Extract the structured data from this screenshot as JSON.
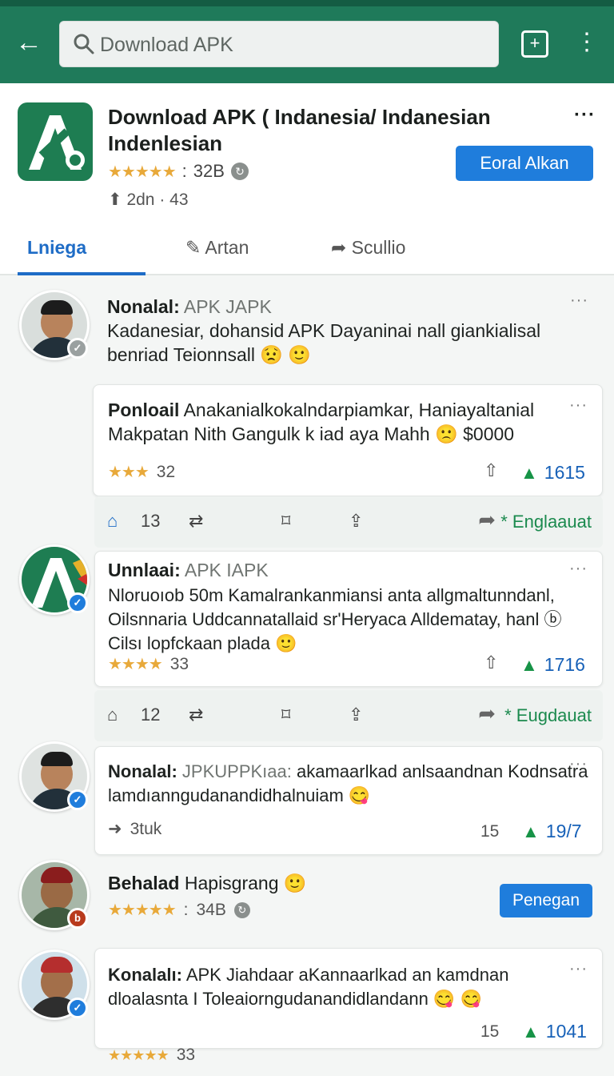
{
  "topbar": {
    "search_placeholder": "Download APK",
    "back_icon": "arrow-left-icon",
    "box_icon": "plus-box-icon",
    "more_icon": "more-vertical-icon"
  },
  "app": {
    "title": "Download APK ( Indanesia/ Indanesian Indenlesian",
    "stars": "★★★★★",
    "rating_sep": ":",
    "rating_value": "32B",
    "sub": "2dn · 43"
  },
  "tabs": [
    {
      "label": "Lniega"
    },
    {
      "label": "Artan"
    },
    {
      "label": "Scullio"
    }
  ],
  "tab_button": "Eoral Alkan",
  "posts": [
    {
      "name": "Nonalal:",
      "handle": "APK JAPK",
      "text": "Kadanesiar, dohansid APK Dayaninai nall giankialisal benriad Teionnsall 😟 🙂"
    },
    {
      "name": "Ponloail",
      "text": "Anakanialkokalndarpiamkar, Haniayaltanial Makpatan Nith Gangulk k iad aya Mahh 🙁 $0000",
      "stars": "★★★",
      "rating": "32",
      "up": "1615"
    },
    {
      "actions": {
        "likes": "13",
        "right": "Englaauat"
      }
    },
    {
      "name": "Unnlaai:",
      "handle": "APK IAPK",
      "text": "Nloruoıob 50m Kamalrankanmiansi anta allgmaltunndanl, Oilsnnaria Uddcannatallaid sr'Heryaca Alldematay, hanl ⓑ Cilsı lopfckaan plada 🙂",
      "stars": "★★★★",
      "rating": "33",
      "up": "1716"
    },
    {
      "actions": {
        "likes": "12",
        "right": "Eugdauat"
      }
    },
    {
      "name": "Nonalal:",
      "handle": "JPKUPPKıaa:",
      "text": "akamaarlkad anlsaandnan Kodnsatra lamdıanngudanandidhalnuiam 😋",
      "share": "3tuk",
      "left_count": "15",
      "up": "19/7"
    },
    {
      "name": "Behalad",
      "handle": "Hapisgrang 🙂",
      "stars": "★★★★★",
      "rating_sep": ":",
      "rating": "34B",
      "follow": "Penegan"
    },
    {
      "name": "Konalalı:",
      "handle": "APK Jiahdaar",
      "text": "aKannaarlkad an kamdnan dloalasnta I Toleaiorngudanandidlandann 😋 😋",
      "left_count": "15",
      "up": "1041",
      "stars": "★★★★★",
      "rating": "33"
    }
  ]
}
